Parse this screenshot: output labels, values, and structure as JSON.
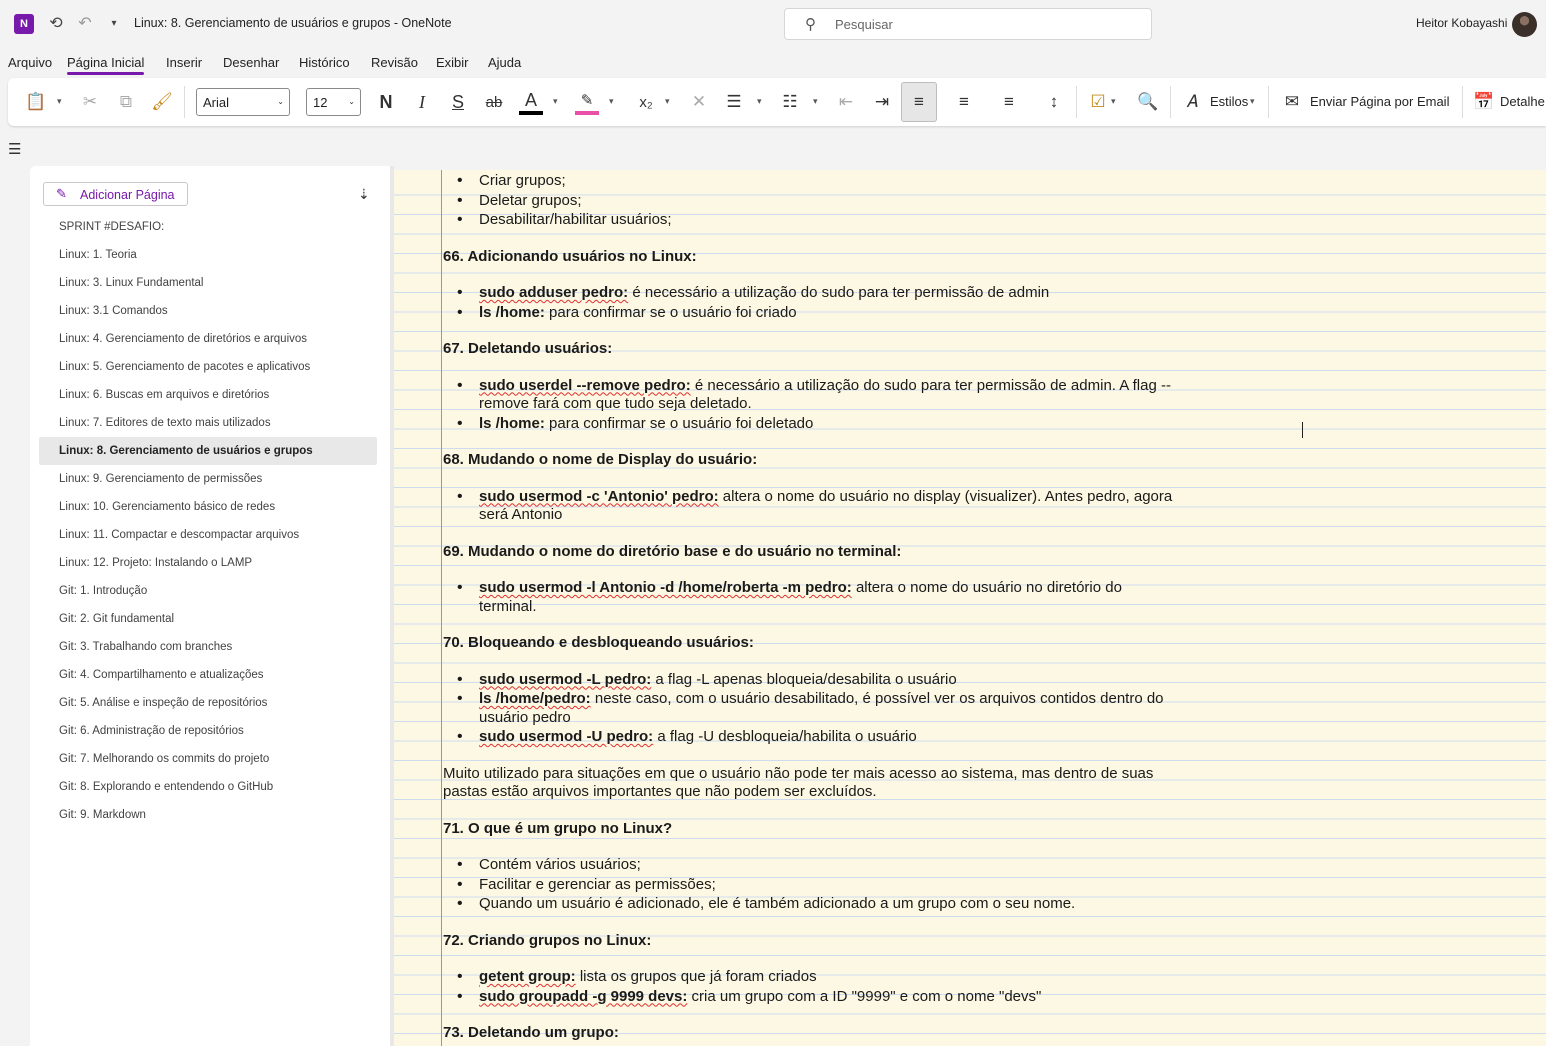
{
  "titlebar": {
    "app_icon": "onenote-icon",
    "title": "Linux: 8. Gerenciamento de usuários e grupos  -  OneNote",
    "search_placeholder": "Pesquisar",
    "user_name": "Heitor Kobayashi"
  },
  "menu": {
    "items": [
      "Arquivo",
      "Página Inicial",
      "Inserir",
      "Desenhar",
      "Histórico",
      "Revisão",
      "Exibir",
      "Ajuda"
    ],
    "active": "Página Inicial"
  },
  "ribbon": {
    "font_name": "Arial",
    "font_size": "12",
    "bold": "N",
    "italic": "I",
    "underline": "S",
    "strike": "ab",
    "font_color_letter": "A",
    "font_color": "#000000",
    "highlight_color": "#e84fa6",
    "styles_label": "Estilos",
    "email_label": "Enviar Página por Email",
    "details_label": "Detalhe"
  },
  "sidebar": {
    "add_page_label": "Adicionar Página",
    "pages": [
      "SPRINT #DESAFIO:",
      "Linux: 1. Teoria",
      "Linux: 3. Linux Fundamental",
      "Linux: 3.1 Comandos",
      "Linux: 4. Gerenciamento de diretórios e arquivos",
      "Linux: 5. Gerenciamento de pacotes e aplicativos",
      "Linux: 6. Buscas em arquivos e diretórios",
      "Linux: 7. Editores de texto mais utilizados",
      "Linux: 8. Gerenciamento de usuários e grupos",
      "Linux: 9. Gerenciamento de permissões",
      "Linux: 10. Gerenciamento básico de redes",
      "Linux: 11. Compactar e descompactar arquivos",
      "Linux: 12. Projeto: Instalando o LAMP",
      "Git: 1. Introdução",
      "Git: 2. Git fundamental",
      "Git: 3. Trabalhando com branches",
      "Git: 4. Compartilhamento e atualizações",
      "Git: 5. Análise e inspeção de repositórios",
      "Git: 6. Administração de repositórios",
      "Git: 7. Melhorando os commits do projeto",
      "Git: 8. Explorando e entendendo o GitHub",
      "Git: 9. Markdown"
    ],
    "selected_index": 8
  },
  "note": {
    "intro_items": [
      "Criar grupos;",
      "Deletar grupos;",
      "Desabilitar/habilitar usuários;"
    ],
    "s66": {
      "heading": "66. Adicionando usuários no Linux:",
      "i1_cmd": "sudo adduser pedro:",
      "i1_text": " é necessário a utilização do sudo para ter permissão de admin",
      "i2_cmd": "ls /home:",
      "i2_text": " para confirmar se o usuário foi criado"
    },
    "s67": {
      "heading": "67. Deletando usuários:",
      "i1_cmd": "sudo userdel --remove pedro:",
      "i1_text": " é necessário a utilização do sudo para ter permissão de admin. A flag --remove fará com que tudo seja deletado.",
      "i2_cmd": "ls /home:",
      "i2_text": " para confirmar se o usuário foi deletado"
    },
    "s68": {
      "heading": "68. Mudando o nome de Display do usuário:",
      "i1_cmd": "sudo usermod -c 'Antonio' pedro:",
      "i1_text": " altera o nome do usuário no display (visualizer). Antes pedro, agora será Antonio"
    },
    "s69": {
      "heading": "69. Mudando o nome do diretório base e do usuário no terminal:",
      "i1_cmd": "sudo usermod -l Antonio -d /home/roberta -m pedro:",
      "i1_text": " altera o nome do usuário no diretório do terminal."
    },
    "s70": {
      "heading": "70. Bloqueando e desbloqueando usuários:",
      "i1_cmd": "sudo usermod -L pedro:",
      "i1_text": " a flag -L apenas bloqueia/desabilita o usuário",
      "i2_cmd": "ls /home/pedro:",
      "i2_text": " neste caso, com o usuário desabilitado, é possível ver os arquivos contidos dentro do usuário pedro",
      "i3_cmd": "sudo usermod -U pedro:",
      "i3_text": " a flag -U desbloqueia/habilita o usuário",
      "paragraph": "Muito utilizado para situações em que o usuário não pode ter mais acesso ao sistema, mas dentro de suas pastas estão arquivos importantes que não podem ser excluídos."
    },
    "s71": {
      "heading": "71. O que é um grupo no Linux?",
      "items": [
        "Contém vários usuários;",
        "Facilitar e gerenciar as permissões;",
        "Quando um usuário é adicionado, ele é também adicionado a um grupo com o seu nome."
      ]
    },
    "s72": {
      "heading": "72. Criando grupos no Linux:",
      "i1_cmd": "getent group:",
      "i1_text": " lista os grupos que já foram criados",
      "i2_cmd": "sudo groupadd -g 9999 devs:",
      "i2_text": " cria um grupo com a ID \"9999\" e com o nome \"devs\""
    },
    "s73": {
      "heading": "73. Deletando um grupo:"
    }
  }
}
